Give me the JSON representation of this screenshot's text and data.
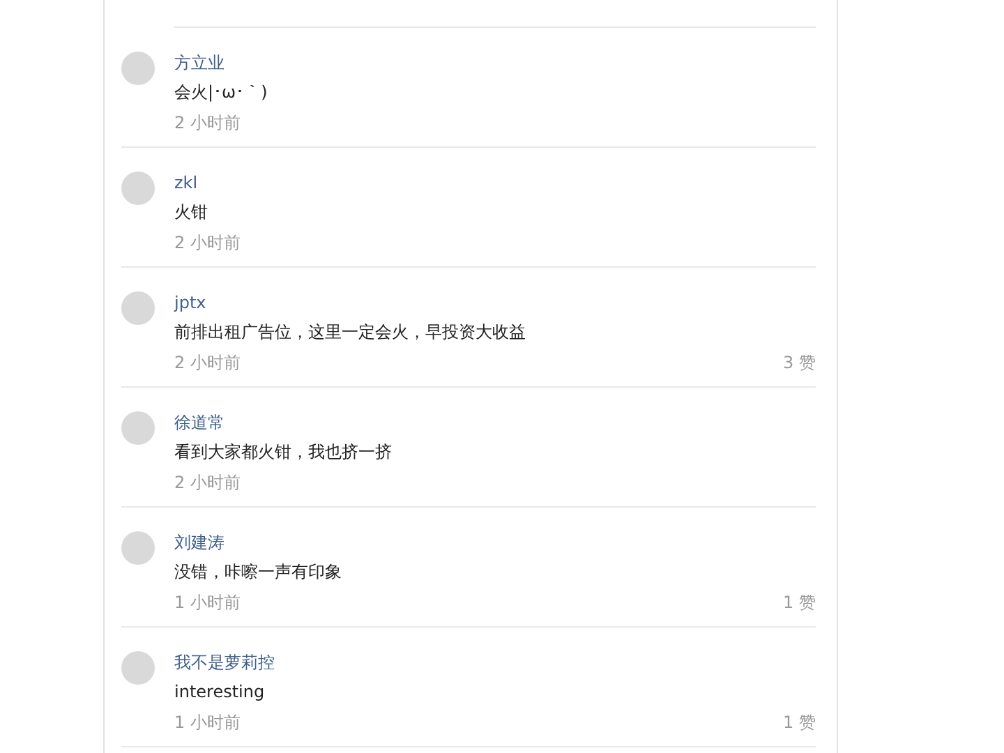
{
  "comments": [
    {
      "author": "方立业",
      "text": "会火|･ω･｀)",
      "time": "2 小时前"
    },
    {
      "author": "zkl",
      "text": "火钳",
      "time": "2 小时前"
    },
    {
      "author": "jptx",
      "text": "前排出租广告位，这里一定会火，早投资大收益",
      "time": "2 小时前",
      "likes": "3 赞"
    },
    {
      "author": "徐道常",
      "text": "看到大家都火钳，我也挤一挤",
      "time": "2 小时前"
    },
    {
      "author": "刘建涛",
      "text": "没错，咔嚓一声有印象",
      "time": "1 小时前",
      "likes": "1 赞"
    },
    {
      "author": "我不是萝莉控",
      "text": "interesting",
      "time": "1 小时前",
      "likes": "1 赞"
    }
  ]
}
